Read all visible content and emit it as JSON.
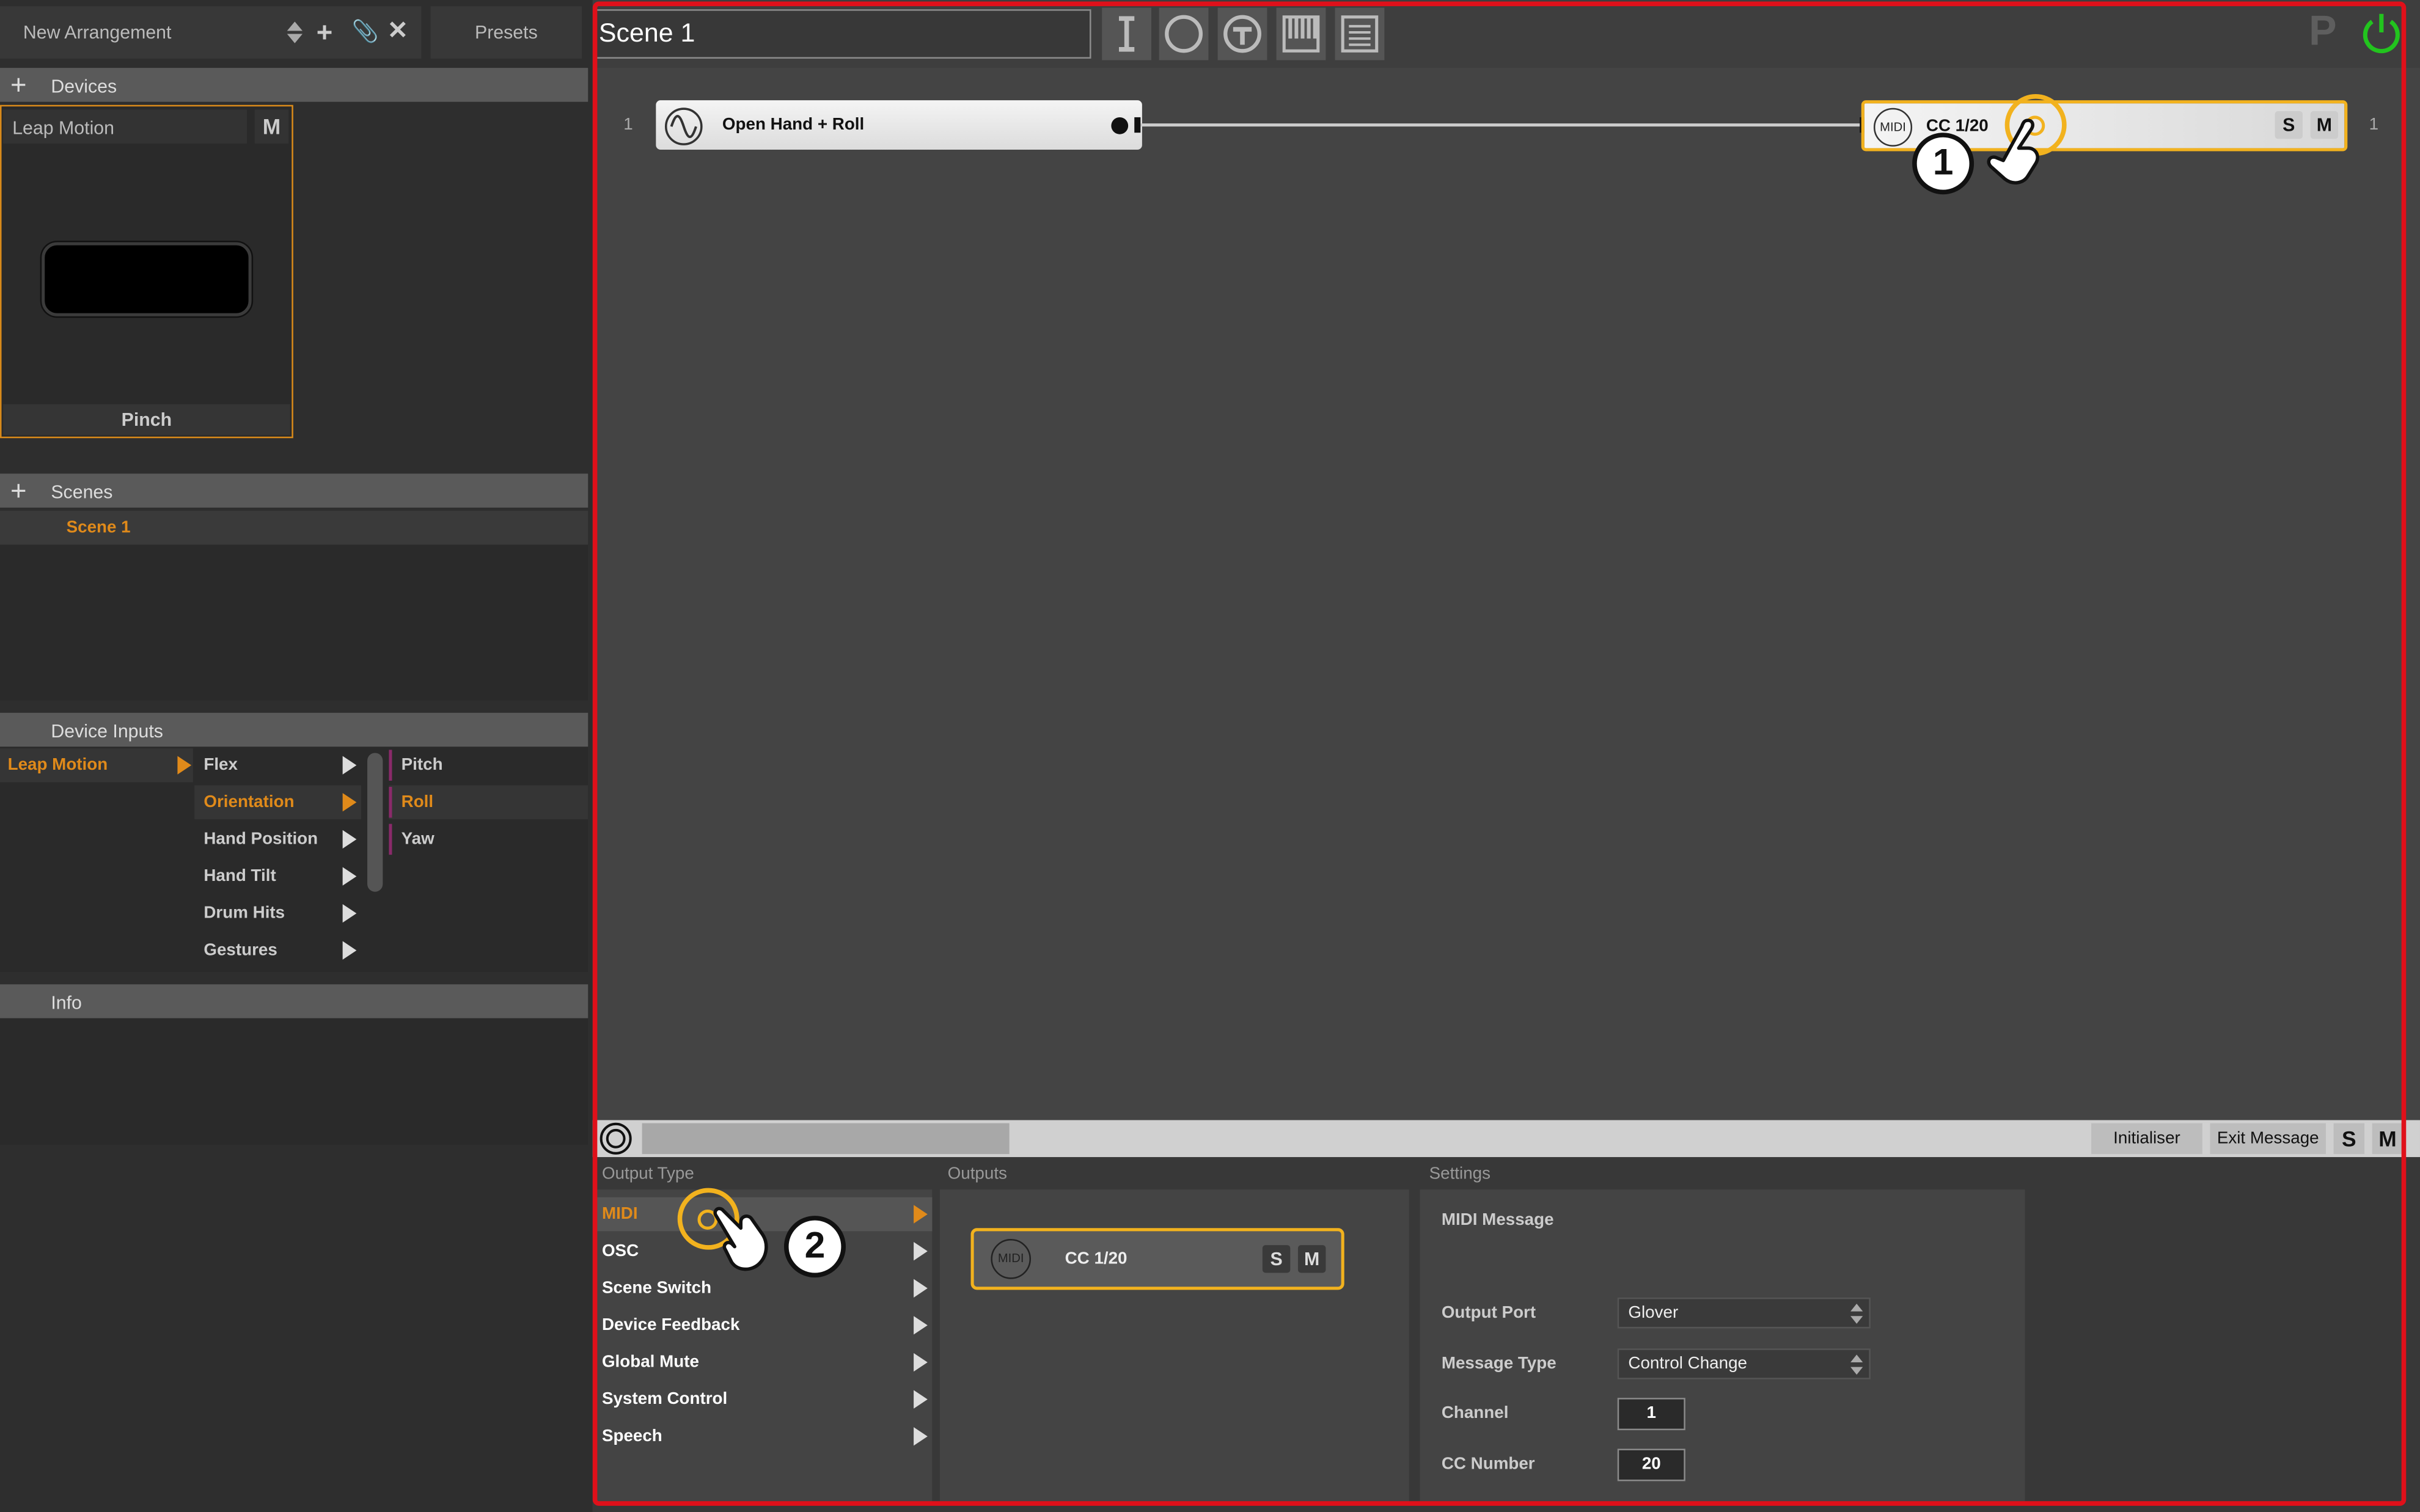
{
  "left": {
    "arrangement": "New Arrangement",
    "presets": "Presets",
    "devices_header": "Devices",
    "device": {
      "name": "Leap Motion",
      "mute": "M",
      "gesture_label": "Pinch"
    },
    "scenes_header": "Scenes",
    "scenes": [
      "Scene 1"
    ],
    "inputs_header": "Device Inputs",
    "input_device": "Leap Motion",
    "categories": [
      "Flex",
      "Orientation",
      "Hand Position",
      "Hand Tilt",
      "Drum Hits",
      "Gestures"
    ],
    "subitems": [
      "Pitch",
      "Roll",
      "Yaw"
    ],
    "info_header": "Info"
  },
  "top": {
    "scene_name": "Scene 1",
    "p_label": "P"
  },
  "canvas": {
    "row_number": "1",
    "input_node": "Open Hand + Roll",
    "output_node": "CC 1/20",
    "midi_badge": "MIDI",
    "solo": "S",
    "mute": "M",
    "right_number": "1"
  },
  "bottom": {
    "initialiser": "Initialiser",
    "exit_message": "Exit Message",
    "solo": "S",
    "mute": "M",
    "output_type_header": "Output Type",
    "output_types": [
      "MIDI",
      "OSC",
      "Scene Switch",
      "Device Feedback",
      "Global Mute",
      "System Control",
      "Speech"
    ],
    "outputs_header": "Outputs",
    "output_card": {
      "badge": "MIDI",
      "label": "CC 1/20",
      "solo": "S",
      "mute": "M"
    },
    "settings_header": "Settings",
    "settings_title": "MIDI Message",
    "output_port_label": "Output Port",
    "output_port_value": "Glover",
    "message_type_label": "Message Type",
    "message_type_value": "Control Change",
    "channel_label": "Channel",
    "channel_value": "1",
    "cc_label": "CC Number",
    "cc_value": "20"
  },
  "annotations": {
    "step1": "1",
    "step2": "2"
  },
  "colors": {
    "accent": "#e08a1a",
    "highlight": "#f2b21e",
    "frame": "#e0101a",
    "power": "#22c41e"
  }
}
